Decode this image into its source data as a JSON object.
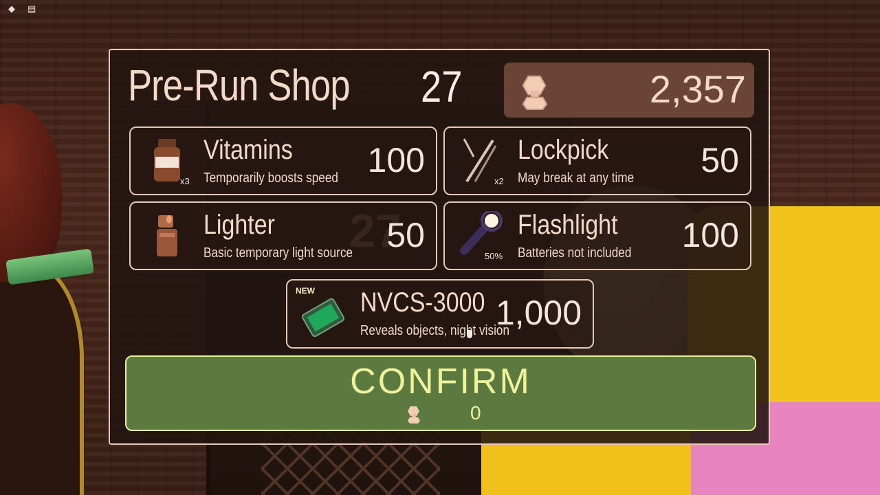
{
  "shop": {
    "title": "Pre-Run Shop",
    "timer": "27",
    "balance": "2,357",
    "background_number": "27"
  },
  "items": [
    {
      "id": "vitamins",
      "name": "Vitamins",
      "desc": "Temporarily boosts speed",
      "price": "100",
      "qty": "x3",
      "icon": "vitamins-bottle-icon"
    },
    {
      "id": "lockpick",
      "name": "Lockpick",
      "desc": "May break at any time",
      "price": "50",
      "qty": "x2",
      "icon": "lockpick-icon"
    },
    {
      "id": "lighter",
      "name": "Lighter",
      "desc": "Basic temporary light source",
      "price": "50",
      "qty": "",
      "icon": "lighter-icon"
    },
    {
      "id": "flashlight",
      "name": "Flashlight",
      "desc": "Batteries not included",
      "price": "100",
      "qty": "50%",
      "icon": "flashlight-icon"
    },
    {
      "id": "nvcs",
      "name": "NVCS-3000",
      "desc": "Reveals objects, night vision",
      "price": "1,000",
      "badge": "NEW",
      "icon": "night-vision-card-icon"
    }
  ],
  "confirm": {
    "label": "CONFIRM",
    "cost": "0"
  },
  "colors": {
    "panel_text": "#f3d9c8",
    "confirm_bg": "#5c7a3f",
    "confirm_text": "#eef29a",
    "balance_bg": "#6a4537"
  }
}
